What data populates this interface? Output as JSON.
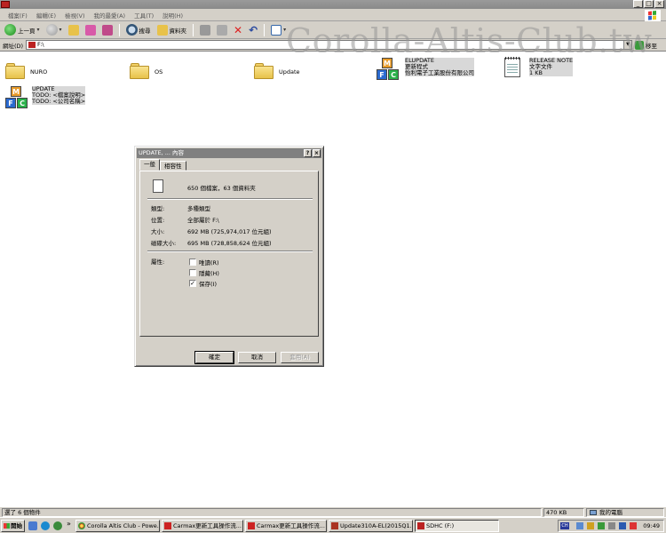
{
  "window": {
    "title": ""
  },
  "menu": [
    "檔案(F)",
    "編輯(E)",
    "檢視(V)",
    "我的最愛(A)",
    "工具(T)",
    "說明(H)"
  ],
  "toolbar": {
    "back": "上一頁",
    "search": "搜尋",
    "folders": "資料夾"
  },
  "address": {
    "label": "網址(D)",
    "value": "F:\\",
    "go": "移至"
  },
  "watermark": "Corolla-Altis-Club.tw",
  "files": [
    {
      "name": "NURO",
      "type": "folder"
    },
    {
      "name": "OS",
      "type": "folder"
    },
    {
      "name": "Update",
      "type": "folder"
    },
    {
      "name": "ELUPDATE",
      "line2": "更新程式",
      "line3": "怡利電子工業股份有限公司",
      "type": "mfc"
    },
    {
      "name": "RELEASE NOTE",
      "line2": "文字文件",
      "line3": "1 KB",
      "type": "text"
    },
    {
      "name": "UPDATE",
      "line2": "TODO: <檔案說明>",
      "line3": "TODO: <公司名稱>",
      "type": "mfc"
    }
  ],
  "dialog": {
    "title": "UPDATE, ... 內容",
    "tabs": [
      "一般",
      "相容性"
    ],
    "count": "650 個檔案，63 個資料夾",
    "props": [
      {
        "label": "類型:",
        "value": "多種類型"
      },
      {
        "label": "位置:",
        "value": "全部屬於 F:\\"
      },
      {
        "label": "大小:",
        "value": "692 MB (725,974,017 位元組)"
      },
      {
        "label": "磁碟大小:",
        "value": "695 MB (728,858,624 位元組)"
      }
    ],
    "attr_label": "屬性:",
    "attrs": [
      {
        "label": "唯讀(R)",
        "checked": false
      },
      {
        "label": "隱藏(H)",
        "checked": false
      },
      {
        "label": "保存(I)",
        "checked": true
      }
    ],
    "buttons": {
      "ok": "確定",
      "cancel": "取消",
      "apply": "套用(A)"
    }
  },
  "status": {
    "left": "選了 6 個物件",
    "size": "470 KB",
    "computer": "我的電腦"
  },
  "taskbar": {
    "start": "開始",
    "tasks": [
      "Corolla Altis Club - Powe...",
      "Carmax更新工具操作流...",
      "Carmax更新工具操作流...",
      "Update310A-EL(2015Q1...",
      "SDHC (F:)"
    ],
    "time": "09:49"
  }
}
